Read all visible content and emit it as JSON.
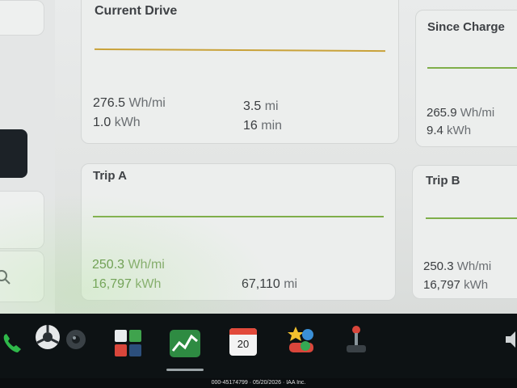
{
  "cards": {
    "current_drive": {
      "title": "Current Drive",
      "efficiency_value": "276.5",
      "efficiency_unit": "Wh/mi",
      "energy_value": "1.0",
      "energy_unit": "kWh",
      "distance_value": "3.5",
      "distance_unit": "mi",
      "duration_value": "16",
      "duration_unit": "min"
    },
    "since_charge": {
      "title": "Since Charge",
      "efficiency_value": "265.9",
      "efficiency_unit": "Wh/mi",
      "energy_value": "9.4",
      "energy_unit": "kWh"
    },
    "trip_a": {
      "title": "Trip A",
      "efficiency_value": "250.3",
      "efficiency_unit": "Wh/mi",
      "energy_value": "16,797",
      "energy_unit": "kWh",
      "distance_value": "67,110",
      "distance_unit": "mi"
    },
    "trip_b": {
      "title": "Trip B",
      "efficiency_value": "250.3",
      "efficiency_unit": "Wh/mi",
      "energy_value": "16,797",
      "energy_unit": "kWh"
    }
  },
  "taskbar": {
    "calendar_day": "20",
    "icons": [
      "phone-icon",
      "camera-icon",
      "dashcam-icon",
      "toybox-icon",
      "energy-icon",
      "calendar-icon",
      "apps-icon",
      "joystick-icon",
      "volume-icon"
    ]
  },
  "colors": {
    "current_drive_line": "#c9a23a",
    "trip_line": "#7fae4a",
    "accent_green": "#5a8a3c"
  },
  "footer": {
    "watermark": "000-45174799 · 05/20/2026 · IAA Inc."
  }
}
